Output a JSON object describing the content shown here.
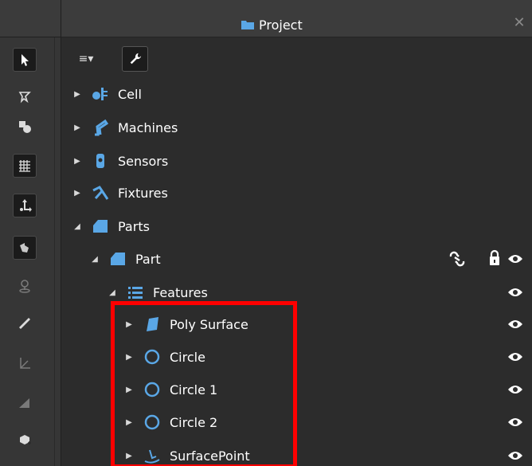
{
  "panel": {
    "title": "Project",
    "close_glyph": "✕",
    "menu_glyph": "≡▾"
  },
  "toolbar": {
    "tools": [
      "select-arrow-icon",
      "teach-icon",
      "objects-icon",
      "grid-icon",
      "move-icon",
      "move-relative-icon",
      "pin-icon",
      "measure-icon",
      "axes-icon",
      "angle-icon",
      "add-object-icon"
    ]
  },
  "tree": {
    "cell": {
      "label": "Cell"
    },
    "machines": {
      "label": "Machines"
    },
    "sensors": {
      "label": "Sensors"
    },
    "fixtures": {
      "label": "Fixtures"
    },
    "parts": {
      "label": "Parts"
    },
    "part": {
      "label": "Part"
    },
    "features": {
      "label": "Features"
    },
    "items": [
      {
        "label": "Poly Surface"
      },
      {
        "label": "Circle"
      },
      {
        "label": "Circle 1"
      },
      {
        "label": "Circle 2"
      },
      {
        "label": "SurfacePoint"
      }
    ]
  },
  "colors": {
    "accent_blue": "#5aa7e6",
    "highlight": "#ff0000",
    "background": "#2c2c2c"
  }
}
